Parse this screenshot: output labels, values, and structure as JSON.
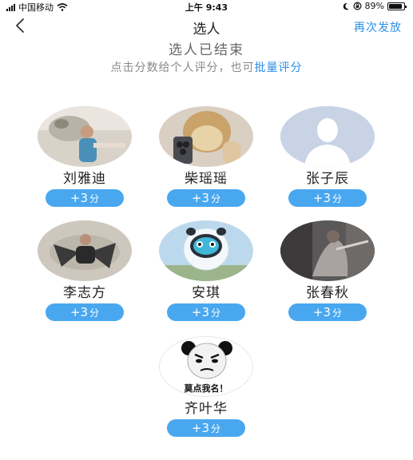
{
  "status": {
    "carrier": "中国移动",
    "time": "上午 9:43",
    "battery_pct": "89%"
  },
  "nav": {
    "title": "选人",
    "action": "再次发放"
  },
  "banner": {
    "ended": "选人已结束",
    "hint_prefix": "点击分数给个人评分，也可",
    "hint_link": "批量评分"
  },
  "people": [
    {
      "name": "刘雅迪",
      "score": "+3",
      "unit": "分"
    },
    {
      "name": "柴瑶瑶",
      "score": "+3",
      "unit": "分"
    },
    {
      "name": "张子辰",
      "score": "+3",
      "unit": "分"
    },
    {
      "name": "李志方",
      "score": "+3",
      "unit": "分"
    },
    {
      "name": "安琪",
      "score": "+3",
      "unit": "分"
    },
    {
      "name": "张春秋",
      "score": "+3",
      "unit": "分"
    },
    {
      "name": "齐叶华",
      "score": "+3",
      "unit": "分"
    }
  ],
  "meme_caption": "莫点我名！"
}
